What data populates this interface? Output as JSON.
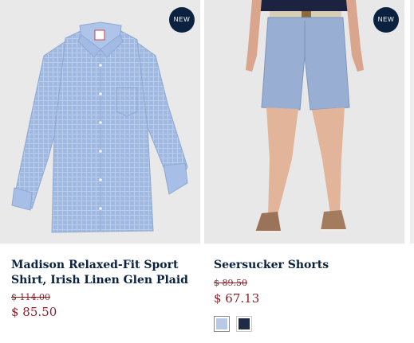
{
  "products": [
    {
      "badge": "NEW",
      "title": "Madison Relaxed-Fit Sport Shirt, Irish Linen Glen Plaid",
      "original_price": "$ 114.00",
      "sale_price": "$ 85.50",
      "image_icon": "shirt-image"
    },
    {
      "badge": "NEW",
      "title": "Seersucker Shorts",
      "original_price": "$ 89.50",
      "sale_price": "$ 67.13",
      "image_icon": "shorts-image",
      "swatches": [
        {
          "color": "#b7c9e6",
          "selected": true
        },
        {
          "color": "#1f2a44",
          "selected": false
        }
      ]
    }
  ],
  "colors": {
    "navy": "#0a2240",
    "price_red": "#8a2027",
    "image_bg": "#e9e9ea"
  }
}
